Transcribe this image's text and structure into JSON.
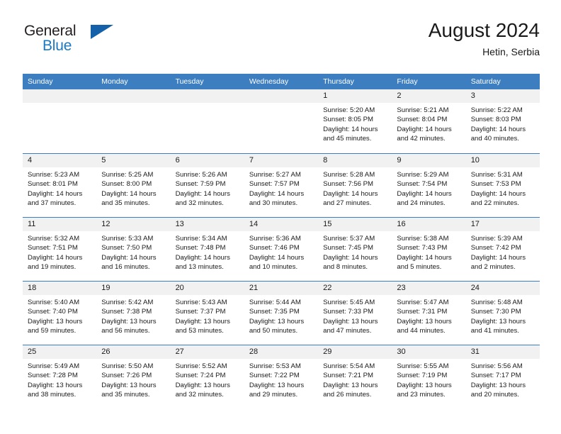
{
  "brand": {
    "name_part1": "General",
    "name_part2": "Blue",
    "triangle_icon": "triangle-icon",
    "accent_color": "#1561a9",
    "text_color": "#231f20"
  },
  "header": {
    "title": "August 2024",
    "subtitle": "Hetin, Serbia"
  },
  "calendar": {
    "header_bg": "#3c7ebf",
    "daynum_bg": "#f1f1f1",
    "weekdays": [
      "Sunday",
      "Monday",
      "Tuesday",
      "Wednesday",
      "Thursday",
      "Friday",
      "Saturday"
    ],
    "weeks": [
      [
        {
          "day": "",
          "sunrise": "",
          "sunset": "",
          "daylight1": "",
          "daylight2": "",
          "empty": true
        },
        {
          "day": "",
          "sunrise": "",
          "sunset": "",
          "daylight1": "",
          "daylight2": "",
          "empty": true
        },
        {
          "day": "",
          "sunrise": "",
          "sunset": "",
          "daylight1": "",
          "daylight2": "",
          "empty": true
        },
        {
          "day": "",
          "sunrise": "",
          "sunset": "",
          "daylight1": "",
          "daylight2": "",
          "empty": true
        },
        {
          "day": "1",
          "sunrise": "Sunrise: 5:20 AM",
          "sunset": "Sunset: 8:05 PM",
          "daylight1": "Daylight: 14 hours",
          "daylight2": "and 45 minutes."
        },
        {
          "day": "2",
          "sunrise": "Sunrise: 5:21 AM",
          "sunset": "Sunset: 8:04 PM",
          "daylight1": "Daylight: 14 hours",
          "daylight2": "and 42 minutes."
        },
        {
          "day": "3",
          "sunrise": "Sunrise: 5:22 AM",
          "sunset": "Sunset: 8:03 PM",
          "daylight1": "Daylight: 14 hours",
          "daylight2": "and 40 minutes."
        }
      ],
      [
        {
          "day": "4",
          "sunrise": "Sunrise: 5:23 AM",
          "sunset": "Sunset: 8:01 PM",
          "daylight1": "Daylight: 14 hours",
          "daylight2": "and 37 minutes."
        },
        {
          "day": "5",
          "sunrise": "Sunrise: 5:25 AM",
          "sunset": "Sunset: 8:00 PM",
          "daylight1": "Daylight: 14 hours",
          "daylight2": "and 35 minutes."
        },
        {
          "day": "6",
          "sunrise": "Sunrise: 5:26 AM",
          "sunset": "Sunset: 7:59 PM",
          "daylight1": "Daylight: 14 hours",
          "daylight2": "and 32 minutes."
        },
        {
          "day": "7",
          "sunrise": "Sunrise: 5:27 AM",
          "sunset": "Sunset: 7:57 PM",
          "daylight1": "Daylight: 14 hours",
          "daylight2": "and 30 minutes."
        },
        {
          "day": "8",
          "sunrise": "Sunrise: 5:28 AM",
          "sunset": "Sunset: 7:56 PM",
          "daylight1": "Daylight: 14 hours",
          "daylight2": "and 27 minutes."
        },
        {
          "day": "9",
          "sunrise": "Sunrise: 5:29 AM",
          "sunset": "Sunset: 7:54 PM",
          "daylight1": "Daylight: 14 hours",
          "daylight2": "and 24 minutes."
        },
        {
          "day": "10",
          "sunrise": "Sunrise: 5:31 AM",
          "sunset": "Sunset: 7:53 PM",
          "daylight1": "Daylight: 14 hours",
          "daylight2": "and 22 minutes."
        }
      ],
      [
        {
          "day": "11",
          "sunrise": "Sunrise: 5:32 AM",
          "sunset": "Sunset: 7:51 PM",
          "daylight1": "Daylight: 14 hours",
          "daylight2": "and 19 minutes."
        },
        {
          "day": "12",
          "sunrise": "Sunrise: 5:33 AM",
          "sunset": "Sunset: 7:50 PM",
          "daylight1": "Daylight: 14 hours",
          "daylight2": "and 16 minutes."
        },
        {
          "day": "13",
          "sunrise": "Sunrise: 5:34 AM",
          "sunset": "Sunset: 7:48 PM",
          "daylight1": "Daylight: 14 hours",
          "daylight2": "and 13 minutes."
        },
        {
          "day": "14",
          "sunrise": "Sunrise: 5:36 AM",
          "sunset": "Sunset: 7:46 PM",
          "daylight1": "Daylight: 14 hours",
          "daylight2": "and 10 minutes."
        },
        {
          "day": "15",
          "sunrise": "Sunrise: 5:37 AM",
          "sunset": "Sunset: 7:45 PM",
          "daylight1": "Daylight: 14 hours",
          "daylight2": "and 8 minutes."
        },
        {
          "day": "16",
          "sunrise": "Sunrise: 5:38 AM",
          "sunset": "Sunset: 7:43 PM",
          "daylight1": "Daylight: 14 hours",
          "daylight2": "and 5 minutes."
        },
        {
          "day": "17",
          "sunrise": "Sunrise: 5:39 AM",
          "sunset": "Sunset: 7:42 PM",
          "daylight1": "Daylight: 14 hours",
          "daylight2": "and 2 minutes."
        }
      ],
      [
        {
          "day": "18",
          "sunrise": "Sunrise: 5:40 AM",
          "sunset": "Sunset: 7:40 PM",
          "daylight1": "Daylight: 13 hours",
          "daylight2": "and 59 minutes."
        },
        {
          "day": "19",
          "sunrise": "Sunrise: 5:42 AM",
          "sunset": "Sunset: 7:38 PM",
          "daylight1": "Daylight: 13 hours",
          "daylight2": "and 56 minutes."
        },
        {
          "day": "20",
          "sunrise": "Sunrise: 5:43 AM",
          "sunset": "Sunset: 7:37 PM",
          "daylight1": "Daylight: 13 hours",
          "daylight2": "and 53 minutes."
        },
        {
          "day": "21",
          "sunrise": "Sunrise: 5:44 AM",
          "sunset": "Sunset: 7:35 PM",
          "daylight1": "Daylight: 13 hours",
          "daylight2": "and 50 minutes."
        },
        {
          "day": "22",
          "sunrise": "Sunrise: 5:45 AM",
          "sunset": "Sunset: 7:33 PM",
          "daylight1": "Daylight: 13 hours",
          "daylight2": "and 47 minutes."
        },
        {
          "day": "23",
          "sunrise": "Sunrise: 5:47 AM",
          "sunset": "Sunset: 7:31 PM",
          "daylight1": "Daylight: 13 hours",
          "daylight2": "and 44 minutes."
        },
        {
          "day": "24",
          "sunrise": "Sunrise: 5:48 AM",
          "sunset": "Sunset: 7:30 PM",
          "daylight1": "Daylight: 13 hours",
          "daylight2": "and 41 minutes."
        }
      ],
      [
        {
          "day": "25",
          "sunrise": "Sunrise: 5:49 AM",
          "sunset": "Sunset: 7:28 PM",
          "daylight1": "Daylight: 13 hours",
          "daylight2": "and 38 minutes."
        },
        {
          "day": "26",
          "sunrise": "Sunrise: 5:50 AM",
          "sunset": "Sunset: 7:26 PM",
          "daylight1": "Daylight: 13 hours",
          "daylight2": "and 35 minutes."
        },
        {
          "day": "27",
          "sunrise": "Sunrise: 5:52 AM",
          "sunset": "Sunset: 7:24 PM",
          "daylight1": "Daylight: 13 hours",
          "daylight2": "and 32 minutes."
        },
        {
          "day": "28",
          "sunrise": "Sunrise: 5:53 AM",
          "sunset": "Sunset: 7:22 PM",
          "daylight1": "Daylight: 13 hours",
          "daylight2": "and 29 minutes."
        },
        {
          "day": "29",
          "sunrise": "Sunrise: 5:54 AM",
          "sunset": "Sunset: 7:21 PM",
          "daylight1": "Daylight: 13 hours",
          "daylight2": "and 26 minutes."
        },
        {
          "day": "30",
          "sunrise": "Sunrise: 5:55 AM",
          "sunset": "Sunset: 7:19 PM",
          "daylight1": "Daylight: 13 hours",
          "daylight2": "and 23 minutes."
        },
        {
          "day": "31",
          "sunrise": "Sunrise: 5:56 AM",
          "sunset": "Sunset: 7:17 PM",
          "daylight1": "Daylight: 13 hours",
          "daylight2": "and 20 minutes."
        }
      ]
    ]
  }
}
